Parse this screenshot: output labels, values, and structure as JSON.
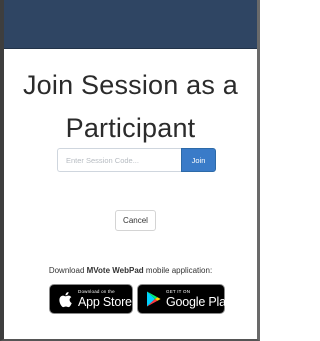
{
  "title": "Join Session as a Participant",
  "title_line1": "Join Session as a",
  "title_line2": "Participant",
  "session_form": {
    "input_placeholder": "Enter Session Code...",
    "input_value": "",
    "join_label": "Join"
  },
  "cancel_label": "Cancel",
  "download": {
    "prefix": "Download ",
    "app_name": "MVote WebPad",
    "suffix": " mobile application:"
  },
  "badges": {
    "apple": {
      "small": "Download on the",
      "big": "App Store",
      "icon": "apple-icon"
    },
    "google": {
      "small": "GET IT ON",
      "big": "Google Play",
      "icon": "google-play-icon"
    }
  },
  "colors": {
    "topbar": "#2f4563",
    "join_button": "#3a7bc8",
    "badge_bg": "#000000"
  }
}
